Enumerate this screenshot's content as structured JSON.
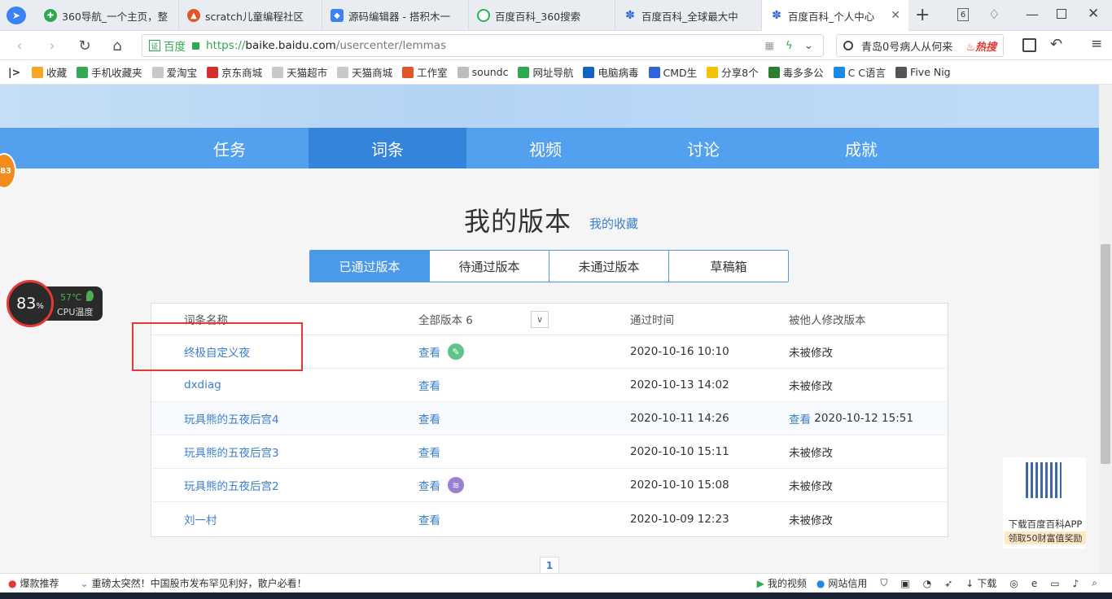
{
  "tabs": [
    {
      "label": "360导航_一个主页，整",
      "color": "#2fa84f"
    },
    {
      "label": "scratch儿童编程社区",
      "color": "#e0562b"
    },
    {
      "label": "源码编辑器 - 搭积木一",
      "color": "#3b82f6"
    },
    {
      "label": "百度百科_360搜索",
      "color": "#24b35a"
    },
    {
      "label": "百度百科_全球最大中",
      "color": "#3064d8"
    },
    {
      "label": "百度百科_个人中心",
      "color": "#3064d8"
    }
  ],
  "browser": {
    "tab_count": "6",
    "address_badge": "百度",
    "url_scheme": "https://",
    "url_host": "baike.baidu.com",
    "url_path": "/usercenter/lemmas",
    "search_text": "青岛0号病人从何来",
    "hot_label": "热搜"
  },
  "bookmarks": [
    {
      "label": "收藏",
      "color": "#f5a623"
    },
    {
      "label": "手机收藏夹",
      "color": "#34a853"
    },
    {
      "label": "爱淘宝",
      "color": "#c8c8c8"
    },
    {
      "label": "京东商城",
      "color": "#d32f2f"
    },
    {
      "label": "天猫超市",
      "color": "#c8c8c8"
    },
    {
      "label": "天猫商城",
      "color": "#c8c8c8"
    },
    {
      "label": "工作室",
      "color": "#e0562b"
    },
    {
      "label": "soundc",
      "color": "#bdbdbd"
    },
    {
      "label": "网址导航",
      "color": "#2fa84f"
    },
    {
      "label": "电脑病毒",
      "color": "#1565c0"
    },
    {
      "label": "CMD生",
      "color": "#3064d8"
    },
    {
      "label": "分享8个",
      "color": "#f2c300"
    },
    {
      "label": "毒多多公",
      "color": "#2e7d32"
    },
    {
      "label": "C C语言",
      "color": "#1e88e5"
    },
    {
      "label": "Five Nig",
      "color": "#555555"
    }
  ],
  "page": {
    "menu": [
      "任务",
      "词条",
      "视频",
      "讨论",
      "成就"
    ],
    "active_menu": 1,
    "heading": "我的版本",
    "fav_link": "我的收藏",
    "segments": [
      "已通过版本",
      "待通过版本",
      "未通过版本",
      "草稿箱"
    ],
    "active_segment": 0,
    "columns": {
      "name": "词条名称",
      "versions": "全部版本 6",
      "time": "通过时间",
      "modified": "被他人修改版本"
    },
    "rows": [
      {
        "name": "终极自定义夜",
        "view": "查看",
        "badge": "edit",
        "time": "2020-10-16 10:10",
        "modified": "未被修改"
      },
      {
        "name": "dxdiag",
        "view": "查看",
        "badge": "",
        "time": "2020-10-13 14:02",
        "modified": "未被修改"
      },
      {
        "name": "玩具熊的五夜后宫4",
        "view": "查看",
        "badge": "",
        "time": "2020-10-11 14:26",
        "modified_link": "查看",
        "modified": "2020-10-12 15:51"
      },
      {
        "name": "玩具熊的五夜后宫3",
        "view": "查看",
        "badge": "",
        "time": "2020-10-10 15:11",
        "modified": "未被修改"
      },
      {
        "name": "玩具熊的五夜后宫2",
        "view": "查看",
        "badge": "layers",
        "time": "2020-10-10 15:08",
        "modified": "未被修改"
      },
      {
        "name": "刘一村",
        "view": "查看",
        "badge": "",
        "time": "2020-10-09 12:23",
        "modified": "未被修改"
      }
    ],
    "page_number": "1"
  },
  "widgets": {
    "side_badge": "83",
    "cpu_percent": "83",
    "cpu_unit": "%",
    "cpu_temp": "57℃",
    "cpu_label": "CPU温度",
    "qr_line1": "下载百度百科APP",
    "qr_line2": "领取50财富值奖励"
  },
  "statusbar": {
    "hot_label": "爆款推荐",
    "news": "重磅太突然！中国股市发布罕见利好，散户必看！",
    "video": "我的视频",
    "trust": "网站信用",
    "download": "下载"
  }
}
